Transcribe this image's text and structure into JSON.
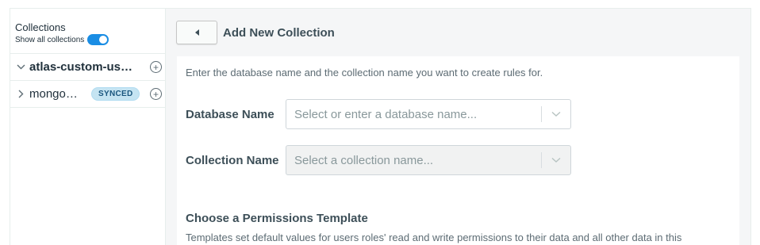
{
  "sidebar": {
    "title": "Collections",
    "show_all_label": "Show all collections",
    "show_all_enabled": true,
    "databases": [
      {
        "name": "atlas-custom-us…",
        "expanded": true
      },
      {
        "name": "mongo…",
        "expanded": false,
        "badge": "SYNCED"
      }
    ]
  },
  "header": {
    "title": "Add New Collection"
  },
  "form": {
    "intro": "Enter the database name and the collection name you want to create rules for.",
    "database_label": "Database Name",
    "database_placeholder": "Select or enter a database name...",
    "collection_label": "Collection Name",
    "collection_placeholder": "Select a collection name..."
  },
  "permissions": {
    "title": "Choose a Permissions Template",
    "description": "Templates set default values for users roles' read and write permissions to their data and all other data in this"
  },
  "colors": {
    "toggle_accent": "#1a8de4",
    "badge_bg": "#c5e4f2",
    "badge_text": "#1a567e"
  }
}
